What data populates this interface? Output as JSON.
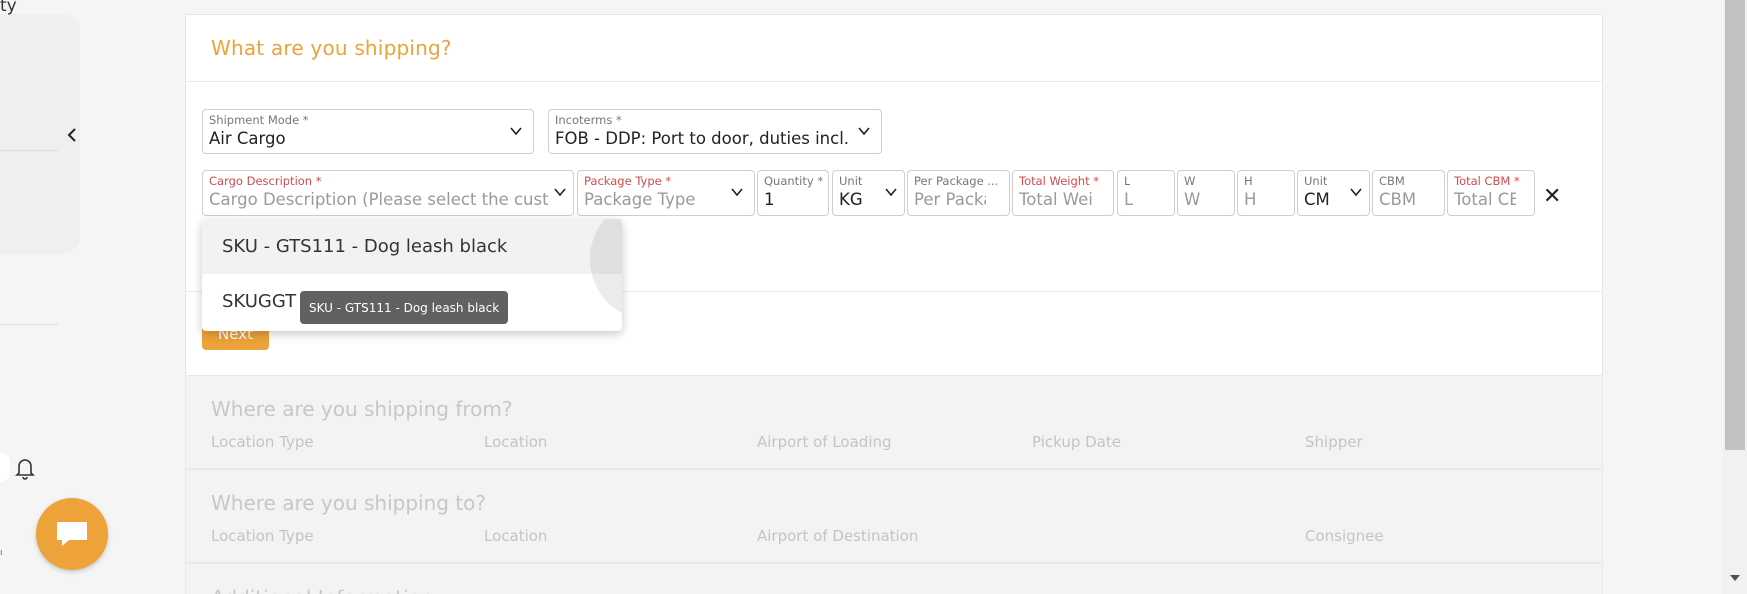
{
  "sidebar": {
    "partial_text": "ty",
    "collapse_icon": "chevron-left-icon",
    "bell_icon": "bell-icon"
  },
  "chat": {
    "icon": "chat-icon"
  },
  "shipping_card": {
    "title": "What are you shipping?",
    "shipment_mode": {
      "label": "Shipment Mode *",
      "value": "Air Cargo"
    },
    "incoterms": {
      "label": "Incoterms *",
      "value": "FOB - DDP: Port to door, duties incl."
    },
    "cargo_description": {
      "label": "Cargo Description *",
      "placeholder": "Cargo Description (Please select the customer first)"
    },
    "package_type": {
      "label": "Package Type *",
      "placeholder": "Package Type"
    },
    "quantity": {
      "label": "Quantity *",
      "value": "1"
    },
    "weight_unit": {
      "label": "Unit",
      "value": "KG"
    },
    "per_package": {
      "label": "Per Package ...",
      "placeholder": "Per Package"
    },
    "total_weight": {
      "label": "Total Weight *",
      "placeholder": "Total Weight"
    },
    "length": {
      "label": "L",
      "placeholder": "L"
    },
    "width": {
      "label": "W",
      "placeholder": "W"
    },
    "height": {
      "label": "H",
      "placeholder": "H"
    },
    "dim_unit": {
      "label": "Unit",
      "value": "CM"
    },
    "cbm": {
      "label": "CBM",
      "placeholder": "CBM"
    },
    "total_cbm": {
      "label": "Total CBM *",
      "placeholder": "Total CBM"
    },
    "next_label": "Next"
  },
  "dropdown": {
    "options": [
      "SKU - GTS111 - Dog leash black",
      "SKUGGT"
    ],
    "tooltip": "SKU - GTS111 - Dog leash black"
  },
  "from_section": {
    "title": "Where are you shipping from?",
    "columns": [
      "Location Type",
      "Location",
      "Airport of Loading",
      "Pickup Date",
      "Shipper"
    ]
  },
  "to_section": {
    "title": "Where are you shipping to?",
    "columns": [
      "Location Type",
      "Location",
      "Airport of Destination",
      "Consignee"
    ]
  },
  "additional_section": {
    "title": "Additional Information"
  },
  "colors": {
    "accent": "#eda23a",
    "required_label": "#d04b4b",
    "tooltip_bg": "#616161"
  }
}
